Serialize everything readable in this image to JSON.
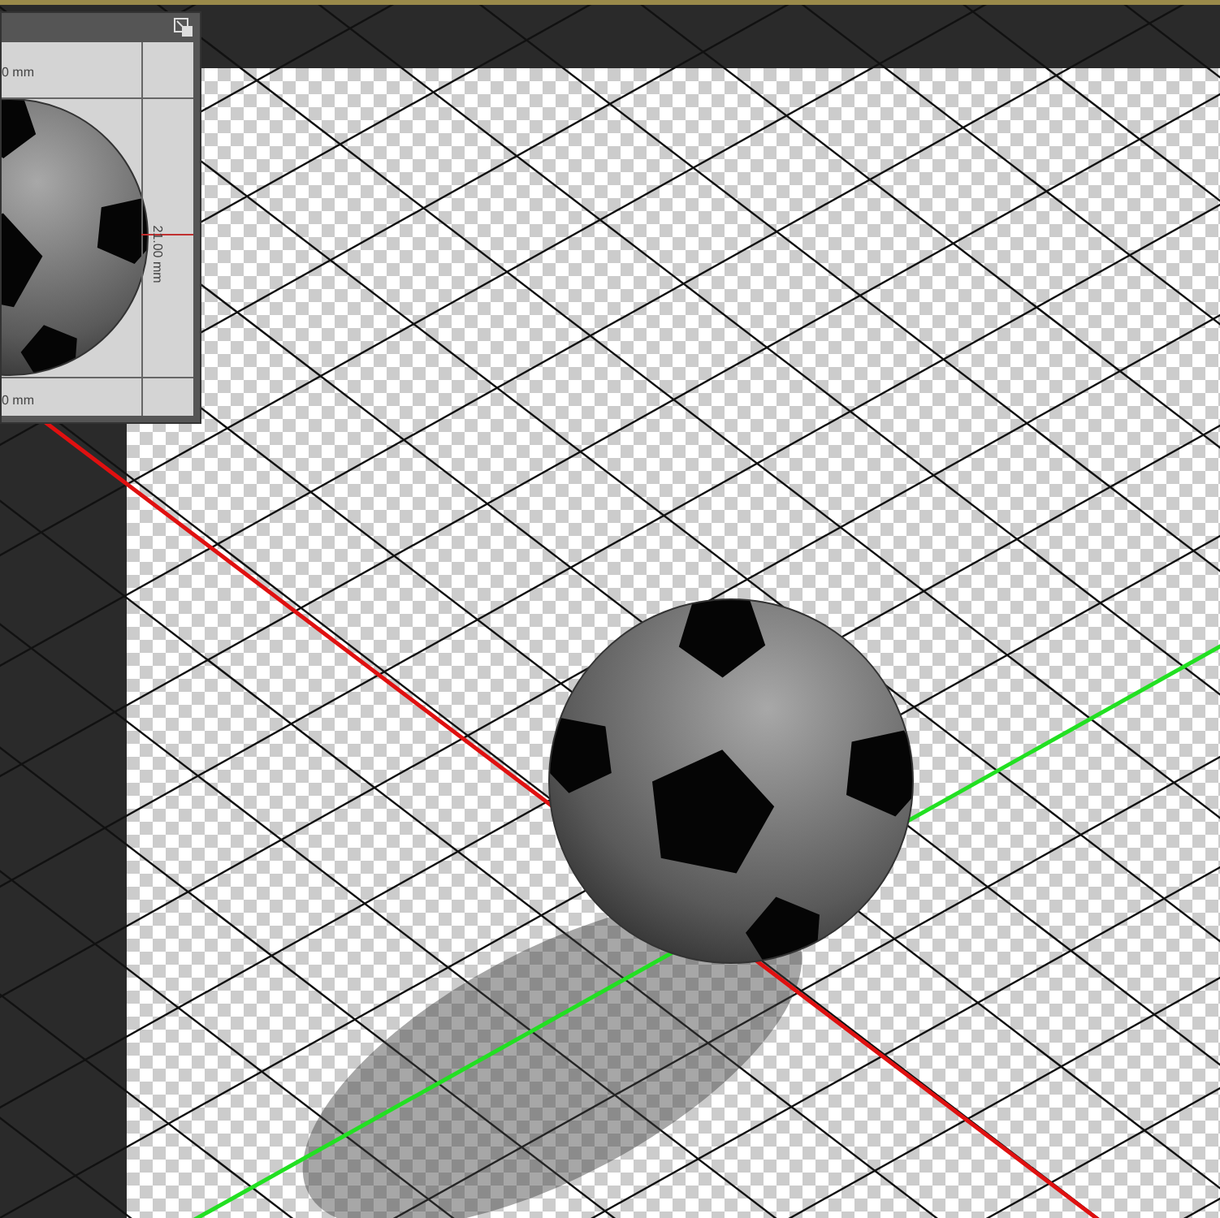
{
  "preview_panel": {
    "top_reading": "0 mm",
    "side_reading": "21.00 mm",
    "bottom_reading": "0 mm"
  }
}
